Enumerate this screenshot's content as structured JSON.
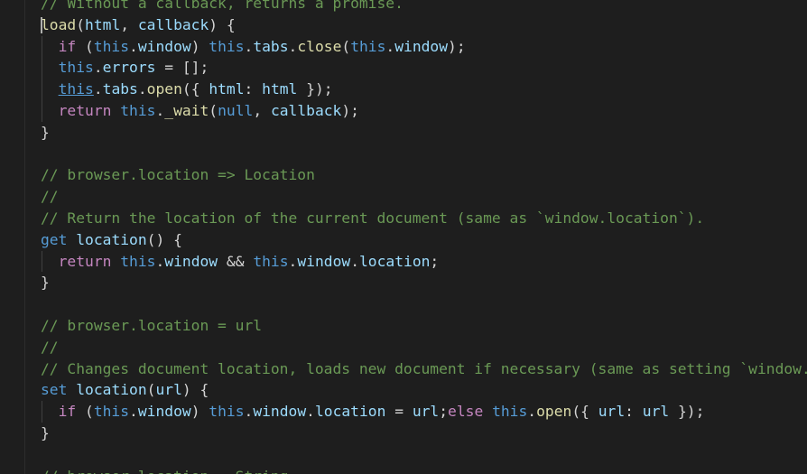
{
  "editor": {
    "colors": {
      "background": "#1e1e1e",
      "comment": "#6a9955",
      "keyword": "#c586c0",
      "this": "#569cd6",
      "function": "#dcdcaa",
      "variable": "#9cdcfe",
      "punctuation": "#d4d4d4"
    },
    "lines": [
      {
        "guide": false,
        "tokens": [
          {
            "t": "// Without a callback, returns a promise.",
            "c": "com"
          }
        ]
      },
      {
        "guide": false,
        "cursor": true,
        "tokens": [
          {
            "t": "load",
            "c": "fn"
          },
          {
            "t": "(",
            "c": "pun"
          },
          {
            "t": "html",
            "c": "var"
          },
          {
            "t": ", ",
            "c": "pun"
          },
          {
            "t": "callback",
            "c": "var"
          },
          {
            "t": ") {",
            "c": "pun"
          }
        ]
      },
      {
        "guide": true,
        "tokens": [
          {
            "t": "  ",
            "c": "pun"
          },
          {
            "t": "if",
            "c": "kw"
          },
          {
            "t": " (",
            "c": "pun"
          },
          {
            "t": "this",
            "c": "this"
          },
          {
            "t": ".",
            "c": "pun"
          },
          {
            "t": "window",
            "c": "var"
          },
          {
            "t": ") ",
            "c": "pun"
          },
          {
            "t": "this",
            "c": "this"
          },
          {
            "t": ".",
            "c": "pun"
          },
          {
            "t": "tabs",
            "c": "var"
          },
          {
            "t": ".",
            "c": "pun"
          },
          {
            "t": "close",
            "c": "fn"
          },
          {
            "t": "(",
            "c": "pun"
          },
          {
            "t": "this",
            "c": "this"
          },
          {
            "t": ".",
            "c": "pun"
          },
          {
            "t": "window",
            "c": "var"
          },
          {
            "t": ");",
            "c": "pun"
          }
        ]
      },
      {
        "guide": true,
        "tokens": [
          {
            "t": "  ",
            "c": "pun"
          },
          {
            "t": "this",
            "c": "this"
          },
          {
            "t": ".",
            "c": "pun"
          },
          {
            "t": "errors",
            "c": "var"
          },
          {
            "t": " = [];",
            "c": "pun"
          }
        ]
      },
      {
        "guide": true,
        "tokens": [
          {
            "t": "  ",
            "c": "pun"
          },
          {
            "t": "this",
            "c": "this",
            "u": true
          },
          {
            "t": ".",
            "c": "pun"
          },
          {
            "t": "tabs",
            "c": "var"
          },
          {
            "t": ".",
            "c": "pun"
          },
          {
            "t": "open",
            "c": "fn"
          },
          {
            "t": "({ ",
            "c": "pun"
          },
          {
            "t": "html",
            "c": "var"
          },
          {
            "t": ": ",
            "c": "pun"
          },
          {
            "t": "html",
            "c": "var"
          },
          {
            "t": " });",
            "c": "pun"
          }
        ]
      },
      {
        "guide": true,
        "tokens": [
          {
            "t": "  ",
            "c": "pun"
          },
          {
            "t": "return",
            "c": "kw"
          },
          {
            "t": " ",
            "c": "pun"
          },
          {
            "t": "this",
            "c": "this"
          },
          {
            "t": ".",
            "c": "pun"
          },
          {
            "t": "_wait",
            "c": "fn"
          },
          {
            "t": "(",
            "c": "pun"
          },
          {
            "t": "null",
            "c": "this"
          },
          {
            "t": ", ",
            "c": "pun"
          },
          {
            "t": "callback",
            "c": "var"
          },
          {
            "t": ");",
            "c": "pun"
          }
        ]
      },
      {
        "guide": false,
        "tokens": [
          {
            "t": "}",
            "c": "pun"
          }
        ]
      },
      {
        "guide": false,
        "tokens": []
      },
      {
        "guide": false,
        "tokens": [
          {
            "t": "// browser.location => Location",
            "c": "com"
          }
        ]
      },
      {
        "guide": false,
        "tokens": [
          {
            "t": "//",
            "c": "com"
          }
        ]
      },
      {
        "guide": false,
        "tokens": [
          {
            "t": "// Return the location of the current document (same as `window.location`).",
            "c": "com"
          }
        ]
      },
      {
        "guide": false,
        "tokens": [
          {
            "t": "get",
            "c": "this"
          },
          {
            "t": " ",
            "c": "pun"
          },
          {
            "t": "location",
            "c": "var"
          },
          {
            "t": "() {",
            "c": "pun"
          }
        ]
      },
      {
        "guide": true,
        "tokens": [
          {
            "t": "  ",
            "c": "pun"
          },
          {
            "t": "return",
            "c": "kw"
          },
          {
            "t": " ",
            "c": "pun"
          },
          {
            "t": "this",
            "c": "this"
          },
          {
            "t": ".",
            "c": "pun"
          },
          {
            "t": "window",
            "c": "var"
          },
          {
            "t": " && ",
            "c": "pun"
          },
          {
            "t": "this",
            "c": "this"
          },
          {
            "t": ".",
            "c": "pun"
          },
          {
            "t": "window",
            "c": "var"
          },
          {
            "t": ".",
            "c": "pun"
          },
          {
            "t": "location",
            "c": "var"
          },
          {
            "t": ";",
            "c": "pun"
          }
        ]
      },
      {
        "guide": false,
        "tokens": [
          {
            "t": "}",
            "c": "pun"
          }
        ]
      },
      {
        "guide": false,
        "tokens": []
      },
      {
        "guide": false,
        "tokens": [
          {
            "t": "// browser.location = url",
            "c": "com"
          }
        ]
      },
      {
        "guide": false,
        "tokens": [
          {
            "t": "//",
            "c": "com"
          }
        ]
      },
      {
        "guide": false,
        "tokens": [
          {
            "t": "// Changes document location, loads new document if necessary (same as setting `window.lo",
            "c": "com"
          }
        ]
      },
      {
        "guide": false,
        "tokens": [
          {
            "t": "set",
            "c": "this"
          },
          {
            "t": " ",
            "c": "pun"
          },
          {
            "t": "location",
            "c": "var"
          },
          {
            "t": "(",
            "c": "pun"
          },
          {
            "t": "url",
            "c": "var"
          },
          {
            "t": ") {",
            "c": "pun"
          }
        ]
      },
      {
        "guide": true,
        "tokens": [
          {
            "t": "  ",
            "c": "pun"
          },
          {
            "t": "if",
            "c": "kw"
          },
          {
            "t": " (",
            "c": "pun"
          },
          {
            "t": "this",
            "c": "this"
          },
          {
            "t": ".",
            "c": "pun"
          },
          {
            "t": "window",
            "c": "var"
          },
          {
            "t": ") ",
            "c": "pun"
          },
          {
            "t": "this",
            "c": "this"
          },
          {
            "t": ".",
            "c": "pun"
          },
          {
            "t": "window",
            "c": "var"
          },
          {
            "t": ".",
            "c": "pun"
          },
          {
            "t": "location",
            "c": "var"
          },
          {
            "t": " = ",
            "c": "pun"
          },
          {
            "t": "url",
            "c": "var"
          },
          {
            "t": ";",
            "c": "pun"
          },
          {
            "t": "else",
            "c": "kw"
          },
          {
            "t": " ",
            "c": "pun"
          },
          {
            "t": "this",
            "c": "this"
          },
          {
            "t": ".",
            "c": "pun"
          },
          {
            "t": "open",
            "c": "fn"
          },
          {
            "t": "({ ",
            "c": "pun"
          },
          {
            "t": "url",
            "c": "var"
          },
          {
            "t": ": ",
            "c": "pun"
          },
          {
            "t": "url",
            "c": "var"
          },
          {
            "t": " });",
            "c": "pun"
          }
        ]
      },
      {
        "guide": false,
        "tokens": [
          {
            "t": "}",
            "c": "pun"
          }
        ]
      },
      {
        "guide": false,
        "tokens": []
      },
      {
        "guide": false,
        "tokens": [
          {
            "t": "// browser.location = String",
            "c": "com"
          }
        ]
      }
    ]
  }
}
